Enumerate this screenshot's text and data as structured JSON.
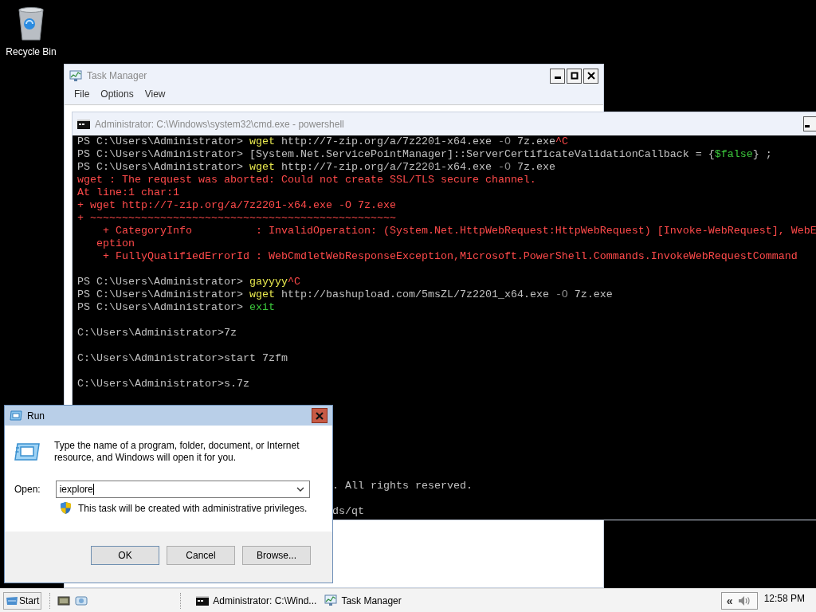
{
  "desktop": {
    "icons": [
      {
        "label": "Recycle Bin"
      }
    ]
  },
  "task_manager": {
    "title": "Task Manager",
    "menu": [
      "File",
      "Options",
      "View"
    ]
  },
  "console": {
    "title": "Administrator: C:\\Windows\\system32\\cmd.exe - powershell",
    "lines": [
      {
        "kind": "text",
        "segments": [
          {
            "kind": "text",
            "text": "PS C:\\Users\\Administrator> "
          },
          {
            "kind": "command",
            "text": "wget"
          },
          {
            "kind": "text",
            "text": " http://7-zip.org/a/7z2201-x64.exe "
          },
          {
            "kind": "param",
            "text": "-O"
          },
          {
            "kind": "text",
            "text": " 7z.exe"
          },
          {
            "kind": "error",
            "text": "^C"
          }
        ]
      },
      {
        "kind": "text",
        "segments": [
          {
            "kind": "text",
            "text": "PS C:\\Users\\Administrator> [System.Net.ServicePointManager]::ServerCertificateValidationCallback = {"
          },
          {
            "kind": "variable",
            "text": "$false"
          },
          {
            "kind": "text",
            "text": "} ;"
          }
        ]
      },
      {
        "kind": "text",
        "segments": [
          {
            "kind": "text",
            "text": "PS C:\\Users\\Administrator> "
          },
          {
            "kind": "command",
            "text": "wget"
          },
          {
            "kind": "text",
            "text": " http://7-zip.org/a/7z2201-x64.exe "
          },
          {
            "kind": "param",
            "text": "-O"
          },
          {
            "kind": "text",
            "text": " 7z.exe"
          }
        ]
      },
      {
        "kind": "text",
        "segments": [
          {
            "kind": "error",
            "text": "wget : The request was aborted: Could not create SSL/TLS secure channel."
          }
        ]
      },
      {
        "kind": "text",
        "segments": [
          {
            "kind": "error",
            "text": "At line:1 char:1"
          }
        ]
      },
      {
        "kind": "text",
        "segments": [
          {
            "kind": "error",
            "text": "+ wget http://7-zip.org/a/7z2201-x64.exe -O 7z.exe"
          }
        ]
      },
      {
        "kind": "text",
        "segments": [
          {
            "kind": "error",
            "text": "+ ~~~~~~~~~~~~~~~~~~~~~~~~~~~~~~~~~~~~~~~~~~~~~~~~"
          }
        ]
      },
      {
        "kind": "text",
        "segments": [
          {
            "kind": "error",
            "text": "    + CategoryInfo          : InvalidOperation: (System.Net.HttpWebRequest:HttpWebRequest) [Invoke-WebRequest], WebE"
          }
        ]
      },
      {
        "kind": "text",
        "segments": [
          {
            "kind": "error",
            "text": "   eption"
          }
        ]
      },
      {
        "kind": "text",
        "segments": [
          {
            "kind": "error",
            "text": "    + FullyQualifiedErrorId : WebCmdletWebResponseException,Microsoft.PowerShell.Commands.InvokeWebRequestCommand"
          }
        ]
      },
      {
        "kind": "blank"
      },
      {
        "kind": "text",
        "segments": [
          {
            "kind": "text",
            "text": "PS C:\\Users\\Administrator> "
          },
          {
            "kind": "command",
            "text": "gayyyy"
          },
          {
            "kind": "error",
            "text": "^C"
          }
        ]
      },
      {
        "kind": "text",
        "segments": [
          {
            "kind": "text",
            "text": "PS C:\\Users\\Administrator> "
          },
          {
            "kind": "command",
            "text": "wget"
          },
          {
            "kind": "text",
            "text": " http://bashupload.com/5msZL/7z2201_x64.exe "
          },
          {
            "kind": "param",
            "text": "-O"
          },
          {
            "kind": "text",
            "text": " 7z.exe"
          }
        ]
      },
      {
        "kind": "text",
        "segments": [
          {
            "kind": "text",
            "text": "PS C:\\Users\\Administrator> "
          },
          {
            "kind": "keyword",
            "text": "exit"
          }
        ]
      },
      {
        "kind": "blank"
      },
      {
        "kind": "text",
        "segments": [
          {
            "kind": "text",
            "text": "C:\\Users\\Administrator>7z"
          }
        ]
      },
      {
        "kind": "blank"
      },
      {
        "kind": "text",
        "segments": [
          {
            "kind": "text",
            "text": "C:\\Users\\Administrator>start 7zfm"
          }
        ]
      },
      {
        "kind": "blank"
      },
      {
        "kind": "text",
        "segments": [
          {
            "kind": "text",
            "text": "C:\\Users\\Administrator>s.7z"
          }
        ]
      },
      {
        "kind": "blank"
      },
      {
        "kind": "blank"
      },
      {
        "kind": "blank"
      },
      {
        "kind": "blank"
      },
      {
        "kind": "blank"
      },
      {
        "kind": "blank"
      },
      {
        "kind": "blank"
      },
      {
        "kind": "covered",
        "segments": [
          {
            "kind": "text",
            "text": ". All rights reserved."
          }
        ]
      },
      {
        "kind": "blank"
      },
      {
        "kind": "covered",
        "segments": [
          {
            "kind": "text",
            "text": "ds/qt"
          }
        ]
      }
    ]
  },
  "run_dialog": {
    "title": "Run",
    "description": "Type the name of a program, folder, document, or Internet resource, and Windows will open it for you.",
    "open_label": "Open:",
    "open_value": "iexplore",
    "admin_note": "This task will be created with administrative privileges.",
    "buttons": [
      {
        "label": "OK",
        "default": true
      },
      {
        "label": "Cancel",
        "default": false
      },
      {
        "label": "Browse...",
        "default": false
      }
    ]
  },
  "taskbar": {
    "start": "Start",
    "tasks": [
      {
        "kind": "console",
        "label": "Administrator: C:\\Wind..."
      },
      {
        "kind": "taskmgr",
        "label": "Task Manager"
      }
    ],
    "tray_expand": "«",
    "clock": "12:58 PM"
  }
}
